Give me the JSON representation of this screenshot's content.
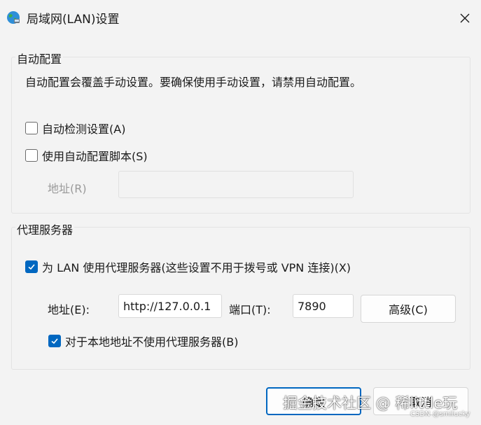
{
  "window": {
    "title": "局域网(LAN)设置",
    "icon": "globe-network-icon"
  },
  "auto_config": {
    "group_label": "自动配置",
    "description": "自动配置会覆盖手动设置。要确保使用手动设置，请禁用自动配置。",
    "auto_detect_label": "自动检测设置(A)",
    "auto_detect_checked": false,
    "use_script_label": "使用自动配置脚本(S)",
    "use_script_checked": false,
    "address_label": "地址(R)",
    "address_value": ""
  },
  "proxy": {
    "group_label": "代理服务器",
    "use_proxy_label": "为 LAN 使用代理服务器(这些设置不用于拨号或 VPN 连接)(X)",
    "use_proxy_checked": true,
    "address_label": "地址(E):",
    "address_value": "http://127.0.0.1",
    "port_label": "端口(T):",
    "port_value": "7890",
    "advanced_label": "高级(C)",
    "bypass_local_label": "对于本地地址不使用代理服务器(B)",
    "bypass_local_checked": true
  },
  "footer": {
    "ok_label": "确定",
    "cancel_label": "取消"
  },
  "watermark": {
    "text": "掘金技术社区 @ 稀little玩",
    "sub": "CSDN @smilucky"
  },
  "colors": {
    "accent": "#0067c0",
    "background": "#f3f3f3"
  }
}
